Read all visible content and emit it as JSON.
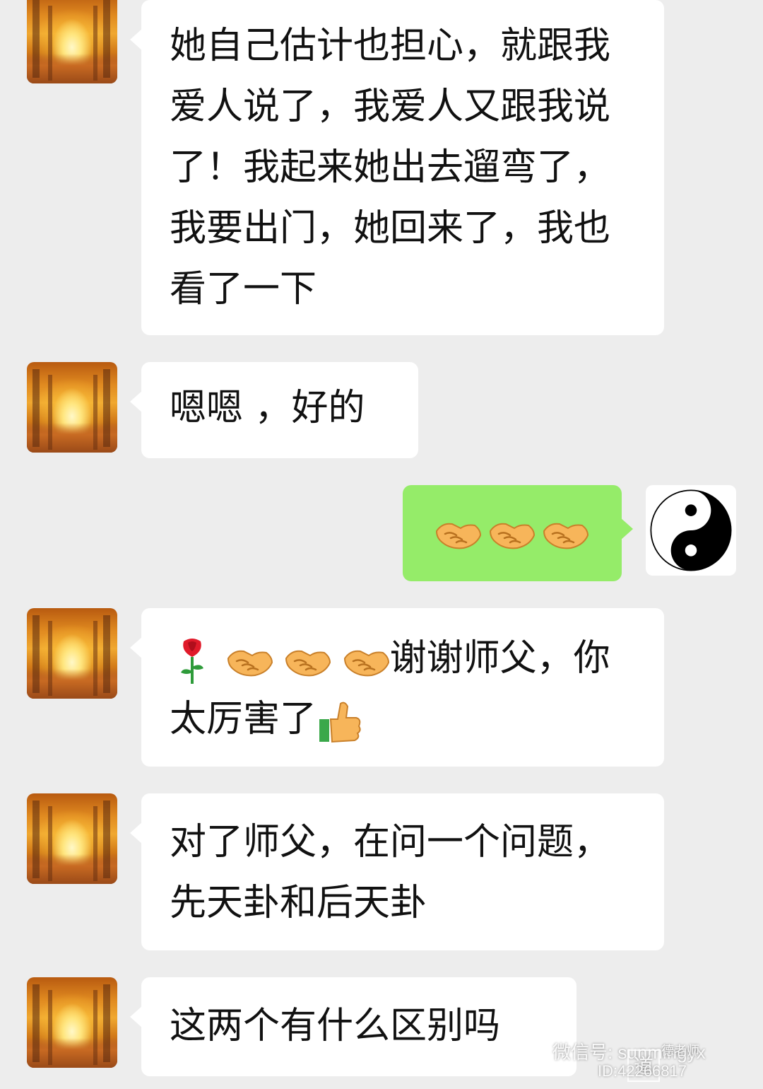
{
  "messages": [
    {
      "side": "left",
      "avatar": "autumn-forest-avatar",
      "text": "她自己估计也担心，就跟我爱人说了，我爱人又跟我说了！我起来她出去遛弯了，我要出门，她回来了，我也看了一下"
    },
    {
      "side": "left",
      "avatar": "autumn-forest-avatar",
      "text": "嗯嗯 ，好的"
    },
    {
      "side": "right",
      "avatar": "yin-yang-avatar",
      "emojis": [
        "handshake",
        "handshake",
        "handshake"
      ]
    },
    {
      "side": "left",
      "avatar": "autumn-forest-avatar",
      "emojis_before": [
        "rose",
        "handshake",
        "handshake",
        "handshake"
      ],
      "text_a": "谢谢师父，你太厉害了",
      "emojis_after": [
        "thumbs-up"
      ]
    },
    {
      "side": "left",
      "avatar": "autumn-forest-avatar",
      "text": "对了师父，在问一个问题，先天卦和后天卦"
    },
    {
      "side": "left",
      "avatar": "autumn-forest-avatar",
      "text": "这两个有什么区别吗"
    }
  ],
  "watermark": {
    "line1": "微信号: sunmingyx",
    "seal": "道",
    "seal_text": "德老师",
    "line2": "ID:42266817"
  },
  "colors": {
    "background": "#ededed",
    "received_bubble": "#ffffff",
    "sent_bubble": "#95ec69",
    "text": "#111111"
  }
}
